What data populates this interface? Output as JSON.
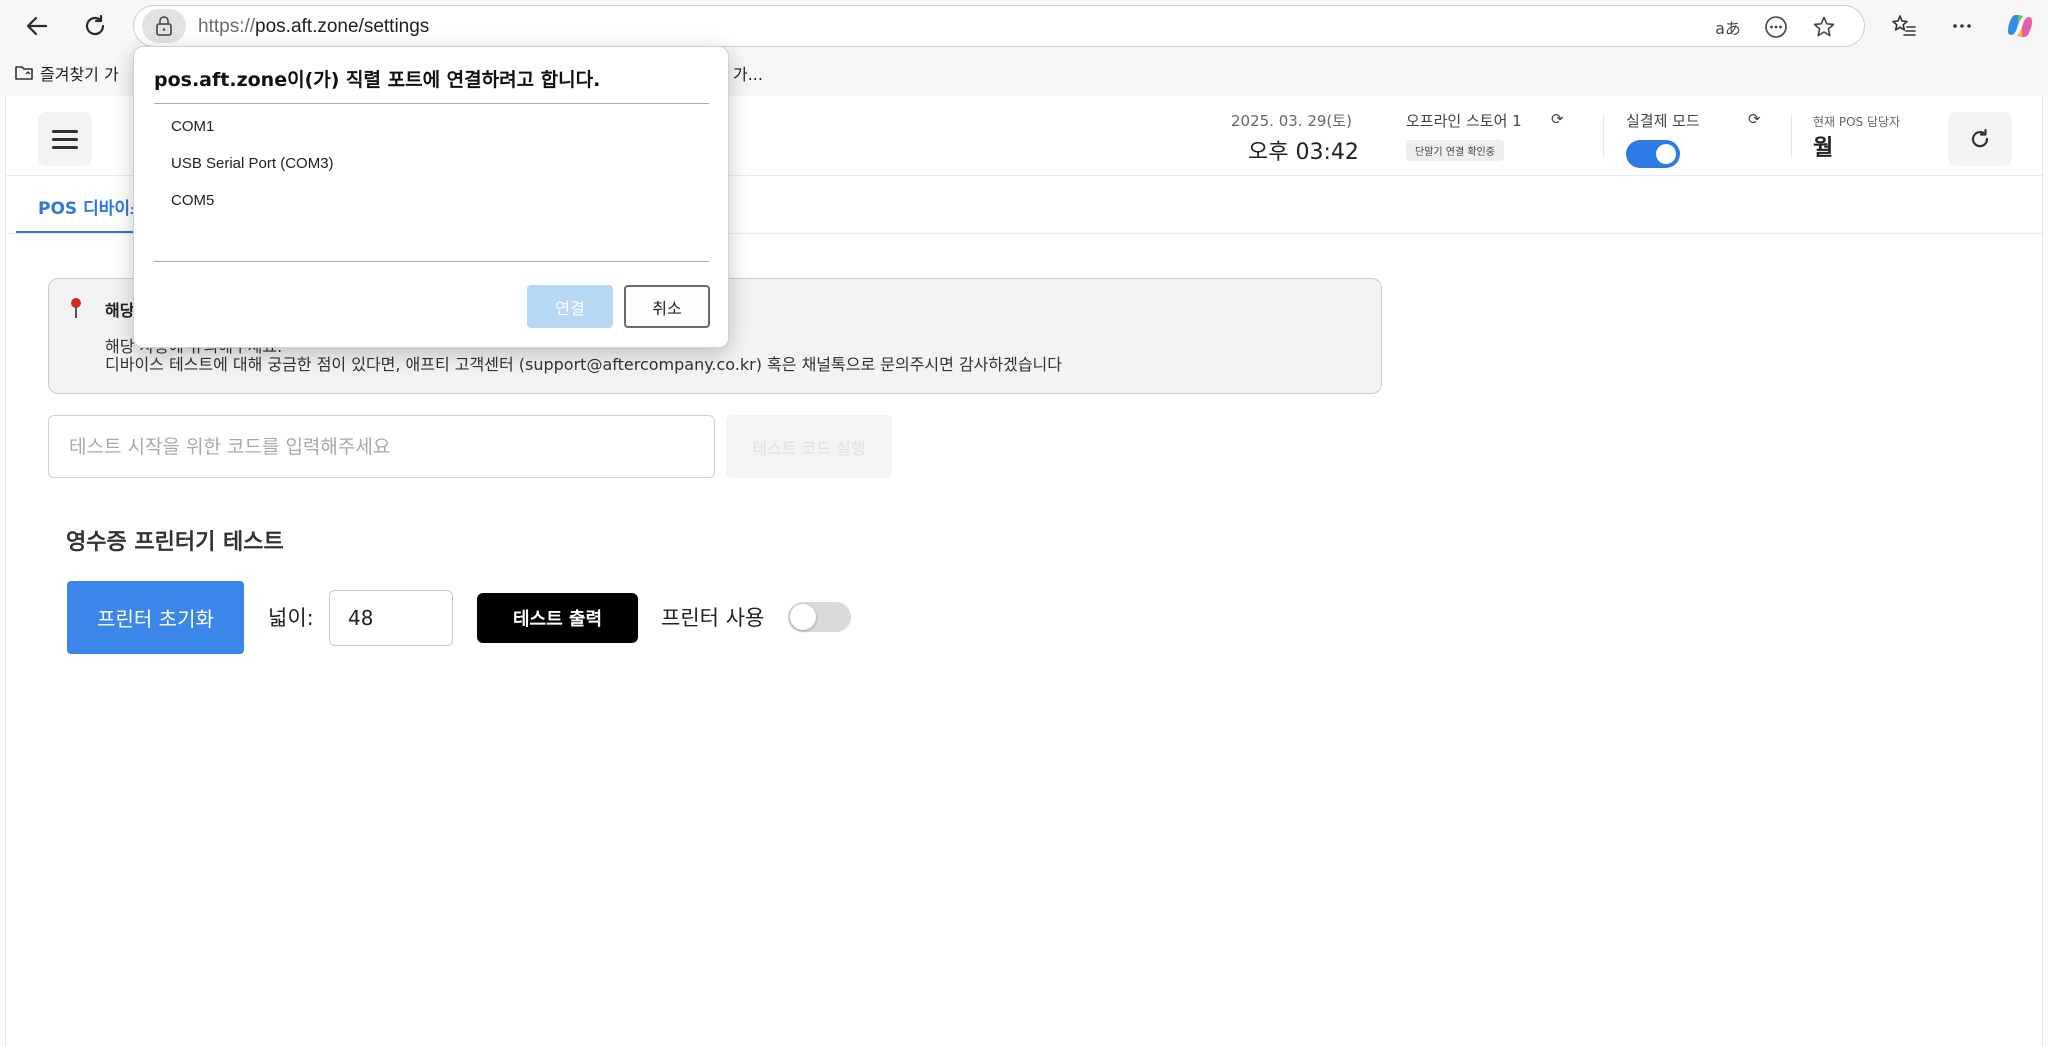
{
  "browser": {
    "url_protocol": "https://",
    "url_rest": "pos.aft.zone/settings",
    "favorites_label": "즐겨찾기 가",
    "favorites_tail": "가...",
    "icons": {
      "back": "back-arrow-icon",
      "reload": "reload-icon",
      "lock": "lock-icon",
      "translate": "translate-icon",
      "more_page": "ellipsis-circle-icon",
      "favorite": "star-icon",
      "favorites_list": "favorites-list-icon",
      "menu": "more-horizontal-icon",
      "copilot": "copilot-icon"
    }
  },
  "header": {
    "date": "2025. 03. 29(토)",
    "time": "오후 03:42",
    "store_name": "오프라인 스토어 1",
    "store_badge": "단말기 연결 확인중",
    "mode_label": "실결제 모드",
    "mode_on": true,
    "manager_label": "현재 POS 담당자",
    "manager_name": "월"
  },
  "tabs": {
    "active_label": "POS 디바이스"
  },
  "notice": {
    "title": "해당",
    "line1": "해당 사용에 유의해주세요.",
    "line2": "디바이스 테스트에 대해 궁금한 점이 있다면, 애프티 고객센터 (support@aftercompany.co.kr) 혹은 채널톡으로 문의주시면 감사하겠습니다"
  },
  "code_test": {
    "placeholder": "테스트 시작을 위한 코드를 입력해주세요",
    "value": "",
    "run_label": "테스트 코드 실행"
  },
  "printer": {
    "section_title": "영수증 프린터기 테스트",
    "init_label": "프린터 초기화",
    "width_label": "넓이:",
    "width_value": "48",
    "print_label": "테스트 출력",
    "use_label": "프린터 사용",
    "use_on": false
  },
  "dialog": {
    "title": "pos.aft.zone이(가) 직렬 포트에 연결하려고 합니다.",
    "ports": [
      "COM1",
      "USB Serial Port (COM3)",
      "COM5"
    ],
    "connect_label": "연결",
    "cancel_label": "취소"
  },
  "colors": {
    "accent": "#2a7ad6",
    "primary_button": "#3b86e8",
    "toggle_on": "#2f7be5",
    "connect_disabled": "#b7d8f5"
  }
}
